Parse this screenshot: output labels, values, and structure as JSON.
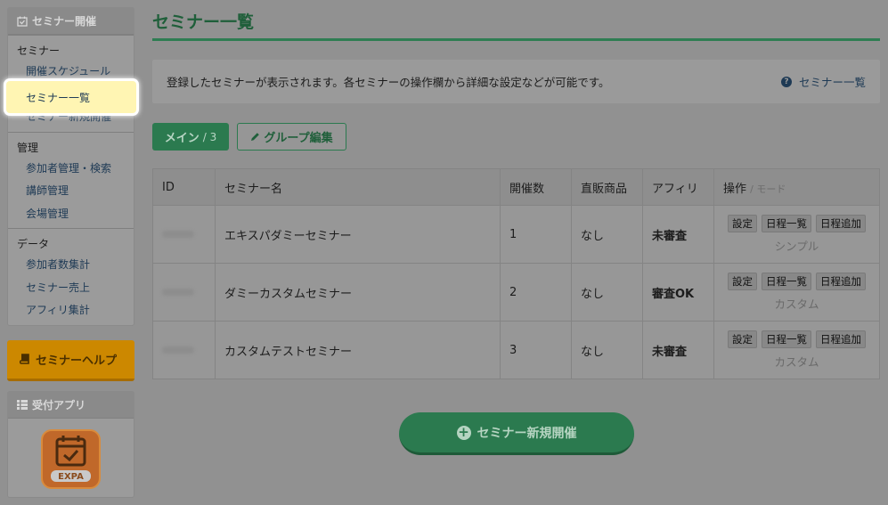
{
  "sidebar": {
    "header": "セミナー開催",
    "sections": [
      {
        "title": "セミナー",
        "items": [
          "開催スケジュール",
          "セミナー一覧",
          "セミナー新規開催"
        ]
      },
      {
        "title": "管理",
        "items": [
          "参加者管理・検索",
          "講師管理",
          "会場管理"
        ]
      },
      {
        "title": "データ",
        "items": [
          "参加者数集計",
          "セミナー売上",
          "アフィリ集計"
        ]
      }
    ],
    "active_item": "セミナー一覧",
    "help_label": "セミナーヘルプ",
    "app_header": "受付アプリ",
    "app_icon": "expa-app-icon",
    "app_icon_text": "EXPA"
  },
  "page": {
    "title": "セミナー一覧",
    "info_text": "登録したセミナーが表示されます。各セミナーの操作欄から詳細な設定などが可能です。",
    "info_link": "セミナー一覧"
  },
  "tabs": {
    "main_label": "メイン",
    "main_count": "/ 3",
    "group_label": "グループ編集"
  },
  "table": {
    "headers": [
      "ID",
      "セミナー名",
      "開催数",
      "直販商品",
      "アフィリ",
      "操作"
    ],
    "header_mode": "/ モード",
    "op_buttons": [
      "設定",
      "日程一覧",
      "日程追加"
    ],
    "rows": [
      {
        "name": "エキスパダミーセミナー",
        "count": "1",
        "product": "なし",
        "affiliate": "未審査",
        "affiliate_ok": false,
        "mode": "シンプル"
      },
      {
        "name": "ダミーカスタムセミナー",
        "count": "2",
        "product": "なし",
        "affiliate": "審査OK",
        "affiliate_ok": true,
        "mode": "カスタム"
      },
      {
        "name": "カスタムテストセミナー",
        "count": "3",
        "product": "なし",
        "affiliate": "未審査",
        "affiliate_ok": false,
        "mode": "カスタム"
      }
    ]
  },
  "new_button_label": "セミナー新規開催",
  "colors": {
    "accent_green": "#2b7a4f",
    "highlight": "#fff5b3",
    "help_orange": "#cc8800"
  }
}
